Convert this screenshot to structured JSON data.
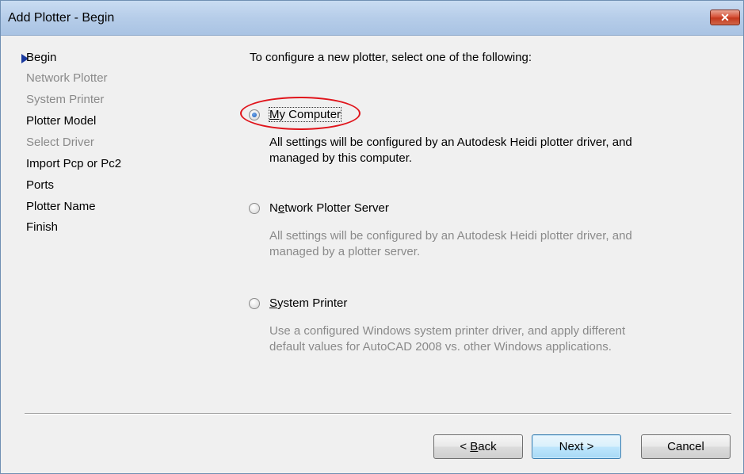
{
  "window": {
    "title": "Add Plotter - Begin",
    "close_label": "✕"
  },
  "steps": [
    {
      "label": "Begin",
      "state": "current"
    },
    {
      "label": "Network Plotter",
      "state": "disabled"
    },
    {
      "label": "System Printer",
      "state": "disabled"
    },
    {
      "label": "Plotter Model",
      "state": "enabled"
    },
    {
      "label": "Select Driver",
      "state": "disabled"
    },
    {
      "label": "Import Pcp or Pc2",
      "state": "enabled"
    },
    {
      "label": "Ports",
      "state": "enabled"
    },
    {
      "label": "Plotter Name",
      "state": "enabled"
    },
    {
      "label": "Finish",
      "state": "enabled"
    }
  ],
  "main": {
    "prompt": "To configure a new plotter, select one of the following:",
    "options": [
      {
        "label_prefix": "",
        "label_mnemonic": "M",
        "label_rest": "y Computer",
        "checked": true,
        "description": "All settings will be configured by an Autodesk Heidi plotter driver, and managed by this computer."
      },
      {
        "label_prefix": "N",
        "label_mnemonic": "e",
        "label_rest": "twork Plotter Server",
        "checked": false,
        "description": "All settings will be configured by an Autodesk Heidi plotter driver, and managed by a plotter server."
      },
      {
        "label_prefix": "",
        "label_mnemonic": "S",
        "label_rest": "ystem Printer",
        "checked": false,
        "description": "Use a configured Windows system printer driver, and apply different default values for AutoCAD 2008 vs. other Windows applications."
      }
    ]
  },
  "buttons": {
    "back_prefix": "< ",
    "back_mnemonic": "B",
    "back_rest": "ack",
    "next": "Next >",
    "cancel": "Cancel"
  },
  "colors": {
    "highlight_ring": "#e0141b",
    "step_arrow": "#1a3a9e",
    "disabled_text": "#8a8a8a"
  }
}
